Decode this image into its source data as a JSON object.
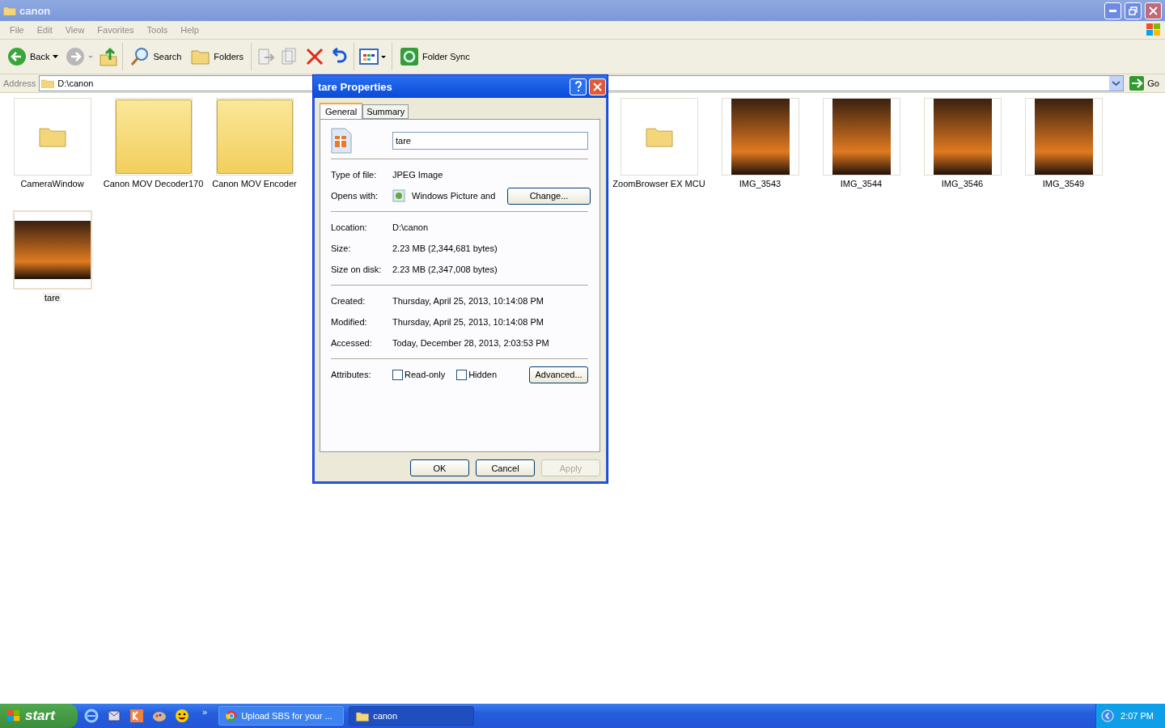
{
  "window": {
    "title": "canon"
  },
  "menu": [
    "File",
    "Edit",
    "View",
    "Favorites",
    "Tools",
    "Help"
  ],
  "toolbar": {
    "back": "Back",
    "search": "Search",
    "folders": "Folders",
    "folder_sync": "Folder Sync"
  },
  "address": {
    "label": "Address",
    "value": "D:\\canon",
    "go": "Go"
  },
  "items": [
    {
      "name": "CameraWindow",
      "kind": "folder",
      "selected": false
    },
    {
      "name": "Canon MOV Decoder170",
      "kind": "media-folder",
      "selected": false
    },
    {
      "name": "Canon MOV Encoder",
      "kind": "media-folder",
      "selected": false
    },
    {
      "name": "ZoomBrowser EX MCU",
      "kind": "folder",
      "selected": false
    },
    {
      "name": "IMG_3543",
      "kind": "photo",
      "selected": false
    },
    {
      "name": "IMG_3544",
      "kind": "photo",
      "selected": false
    },
    {
      "name": "IMG_3546",
      "kind": "photo",
      "selected": false
    },
    {
      "name": "IMG_3549",
      "kind": "photo",
      "selected": false
    },
    {
      "name": "tare",
      "kind": "photo",
      "selected": true
    }
  ],
  "dialog": {
    "title": "tare Properties",
    "tabs": [
      {
        "label": "General",
        "selected": true
      },
      {
        "label": "Summary",
        "selected": false
      }
    ],
    "name_field": "tare",
    "type_label": "Type of file:",
    "type_value": "JPEG Image",
    "opens_label": "Opens with:",
    "opens_value": "Windows Picture and",
    "change": "Change...",
    "groups": [
      [
        {
          "label": "Location:",
          "value": "D:\\canon"
        },
        {
          "label": "Size:",
          "value": "2.23 MB (2,344,681 bytes)"
        },
        {
          "label": "Size on disk:",
          "value": "2.23 MB (2,347,008 bytes)"
        }
      ],
      [
        {
          "label": "Created:",
          "value": "Thursday, April 25, 2013, 10:14:08 PM"
        },
        {
          "label": "Modified:",
          "value": "Thursday, April 25, 2013, 10:14:08 PM"
        },
        {
          "label": "Accessed:",
          "value": "Today, December 28, 2013, 2:03:53 PM"
        }
      ]
    ],
    "attributes_label": "Attributes:",
    "attributes": [
      {
        "label": "Read-only",
        "checked": false
      },
      {
        "label": "Hidden",
        "checked": false
      }
    ],
    "advanced": "Advanced...",
    "buttons": [
      {
        "label": "OK",
        "disabled": false
      },
      {
        "label": "Cancel",
        "disabled": false
      },
      {
        "label": "Apply",
        "disabled": true
      }
    ]
  },
  "taskbar": {
    "start": "start",
    "more": "»",
    "tasks": [
      {
        "label": "Upload SBS for your ...",
        "kind": "browser",
        "selected": false
      },
      {
        "label": "canon",
        "kind": "folder",
        "selected": true
      }
    ],
    "clock": "2:07 PM"
  }
}
